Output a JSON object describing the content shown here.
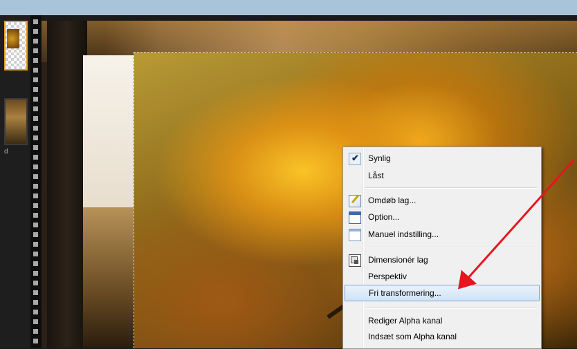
{
  "thumbnail_caption": "d",
  "context_menu": {
    "items": [
      {
        "label": "Synlig",
        "icon": "check-icon",
        "checked": true
      },
      {
        "label": "Låst",
        "icon": ""
      },
      {
        "label": "Omdøb lag...",
        "icon": "rename-icon"
      },
      {
        "label": "Option...",
        "icon": "window-icon"
      },
      {
        "label": "Manuel indstilling...",
        "icon": "window-settings-icon"
      },
      {
        "label": "Dimensionér lag",
        "icon": "resize-icon"
      },
      {
        "label": "Perspektiv",
        "icon": ""
      },
      {
        "label": "Fri transformering...",
        "icon": "",
        "highlighted": true
      },
      {
        "label": "Rediger Alpha kanal",
        "icon": ""
      },
      {
        "label": "Indsæt som Alpha kanal",
        "icon": ""
      }
    ]
  },
  "annotation": {
    "color": "#e8141e"
  }
}
